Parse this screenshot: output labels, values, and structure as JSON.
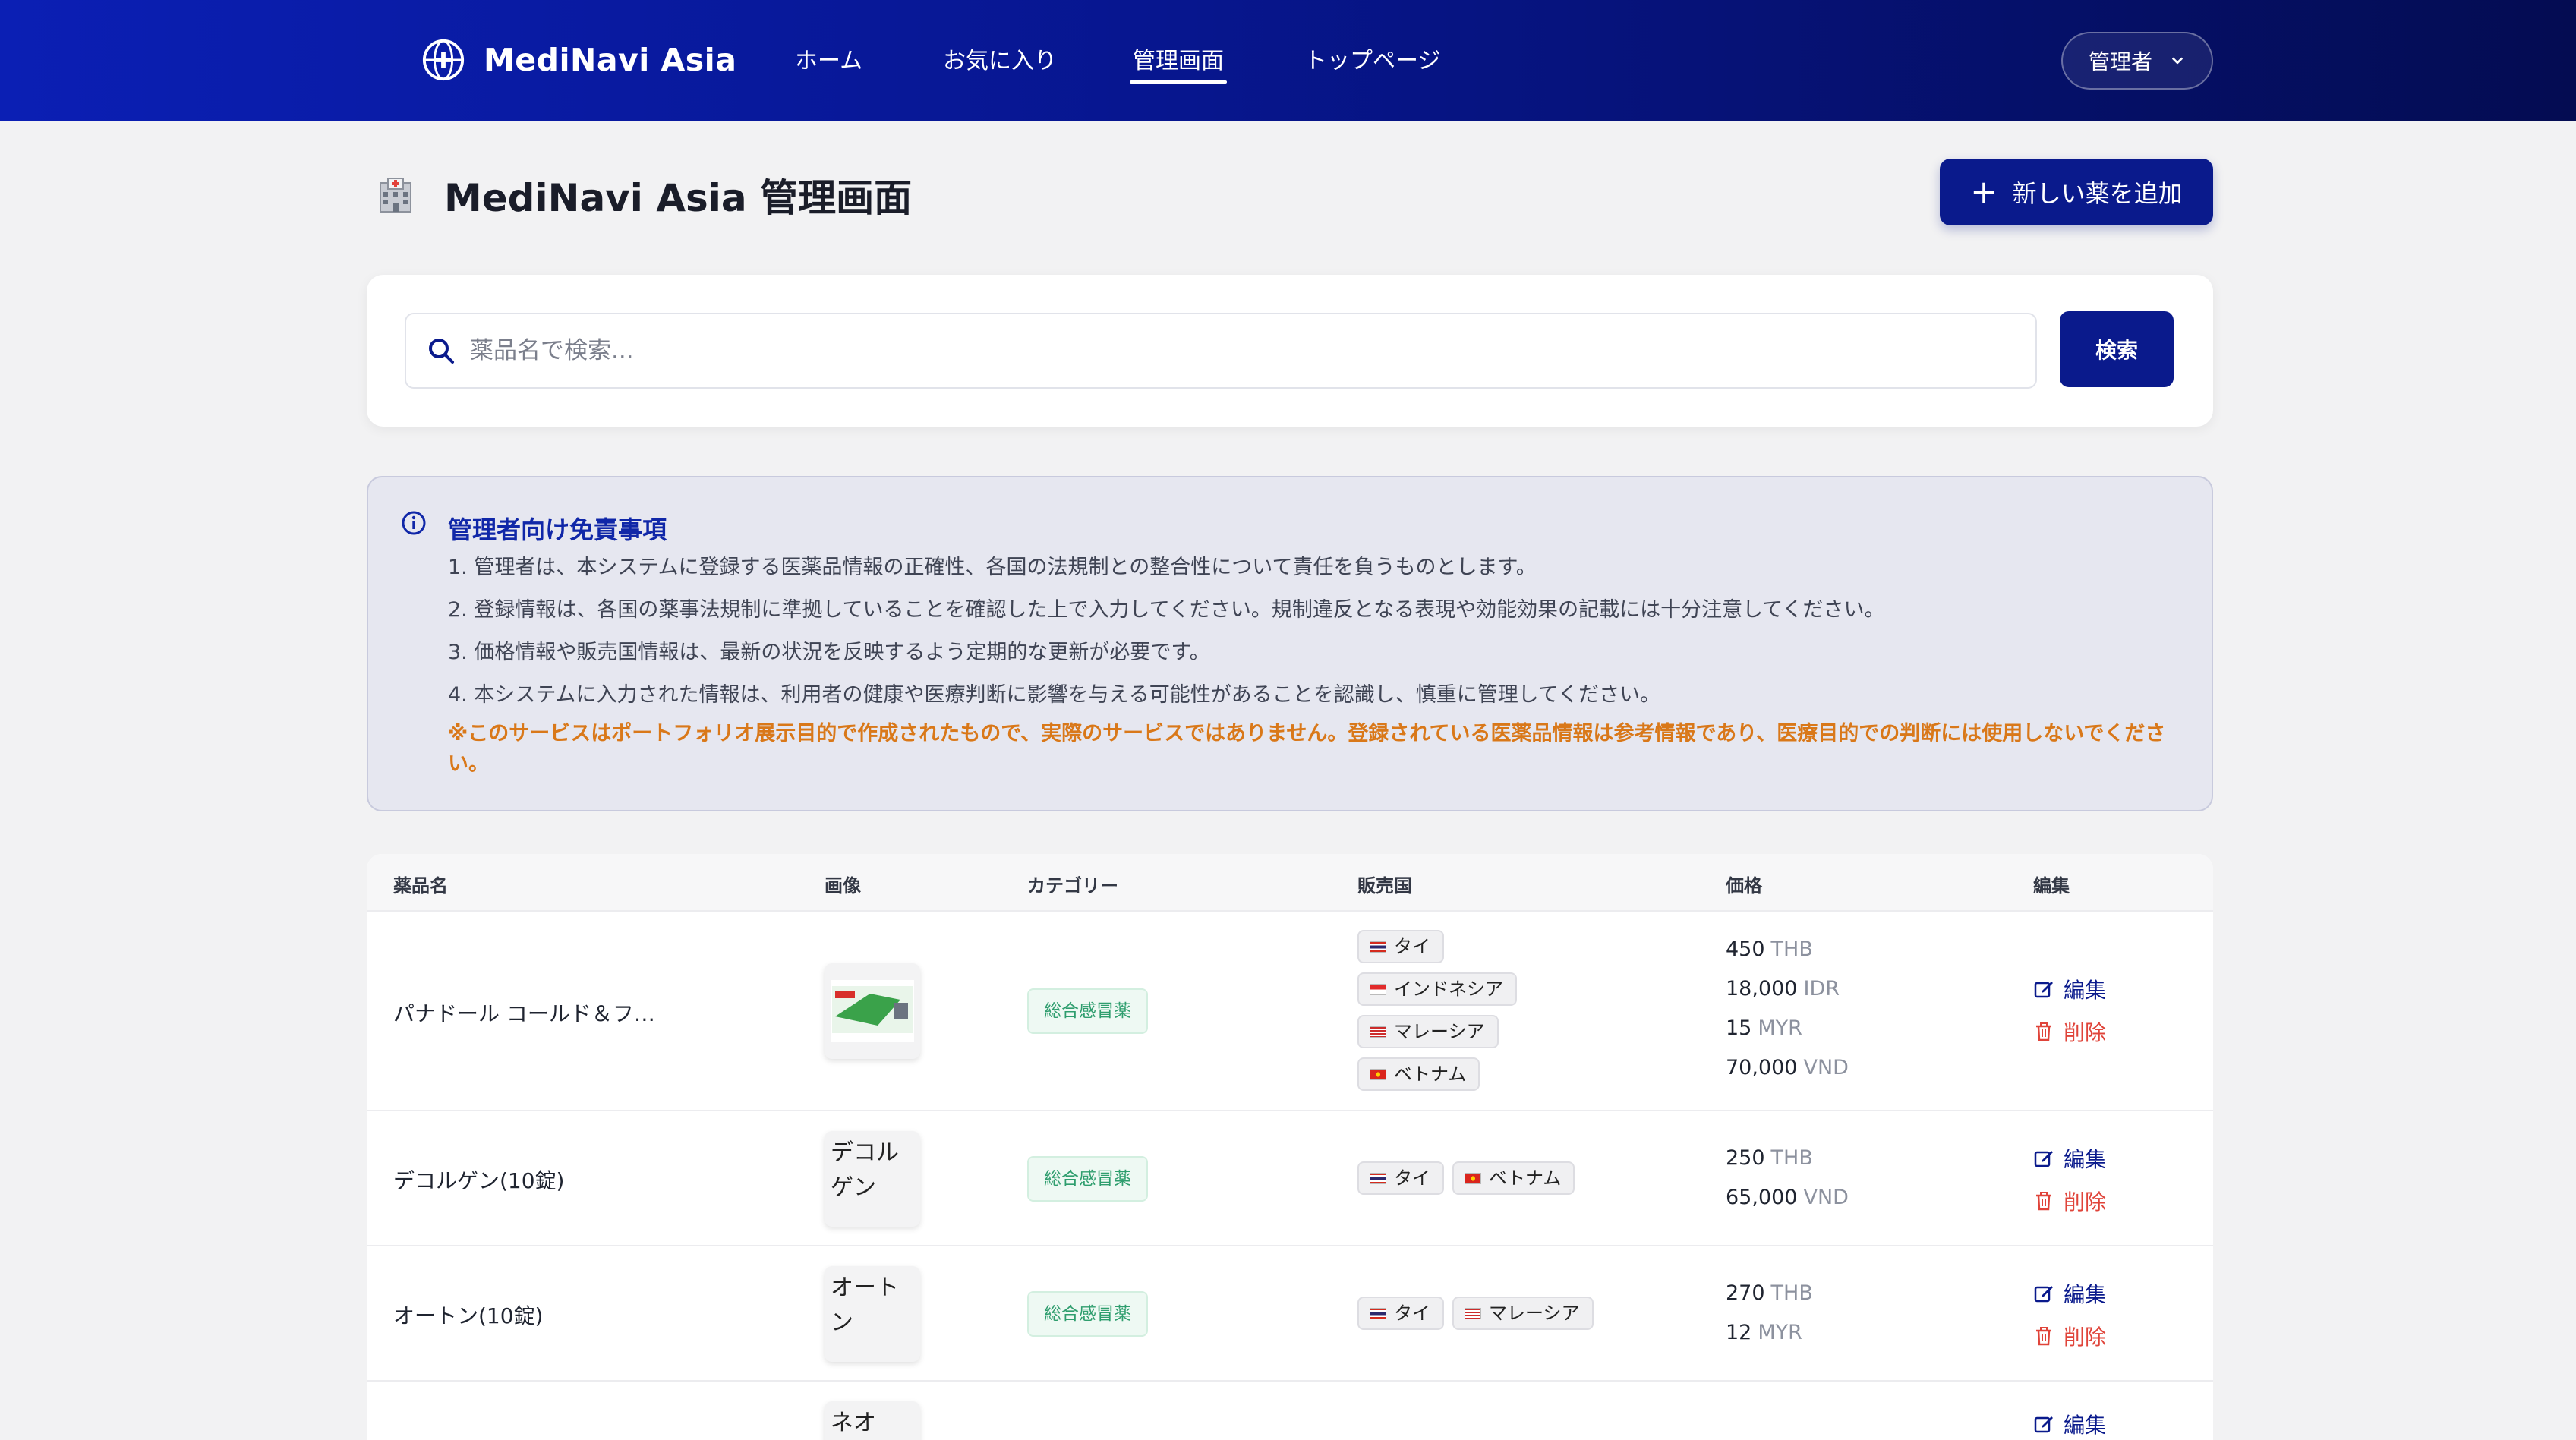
{
  "app": {
    "brand_name": "MediNavi Asia"
  },
  "nav": [
    {
      "label": "ホーム"
    },
    {
      "label": "お気に入り"
    },
    {
      "label": "管理画面",
      "active": true
    },
    {
      "label": "トップページ"
    }
  ],
  "user_menu": {
    "label": "管理者"
  },
  "page": {
    "title": "MediNavi Asia 管理画面",
    "add_button": "新しい薬を追加"
  },
  "search": {
    "placeholder": "薬品名で検索...",
    "button": "検索"
  },
  "disclaimer": {
    "title": "管理者向け免責事項",
    "items": [
      "1. 管理者は、本システムに登録する医薬品情報の正確性、各国の法規制との整合性について責任を負うものとします。",
      "2. 登録情報は、各国の薬事法規制に準拠していることを確認した上で入力してください。規制違反となる表現や効能効果の記載には十分注意してください。",
      "3. 価格情報や販売国情報は、最新の状況を反映するよう定期的な更新が必要です。",
      "4. 本システムに入力された情報は、利用者の健康や医療判断に影響を与える可能性があることを認識し、慎重に管理してください。"
    ],
    "warning": "※このサービスはポートフォリオ展示目的で作成されたもので、実際のサービスではありません。登録されている医薬品情報は参考情報であり、医療目的での判断には使用しないでください。"
  },
  "table": {
    "headers": [
      "薬品名",
      "画像",
      "カテゴリー",
      "販売国",
      "価格",
      "編集"
    ],
    "edit_label": "編集",
    "delete_label": "削除",
    "rows": [
      {
        "name": "パナドール コールド＆フ…",
        "image_alt": "",
        "category": "総合感冒薬",
        "countries": [
          "タイ",
          "インドネシア",
          "マレーシア",
          "ベトナム"
        ],
        "prices": [
          {
            "amount": "450",
            "currency": "THB"
          },
          {
            "amount": "18,000",
            "currency": "IDR"
          },
          {
            "amount": "15",
            "currency": "MYR"
          },
          {
            "amount": "70,000",
            "currency": "VND"
          }
        ]
      },
      {
        "name": "デコルゲン(10錠)",
        "image_alt": "デコルゲン",
        "category": "総合感冒薬",
        "countries": [
          "タイ",
          "ベトナム"
        ],
        "prices": [
          {
            "amount": "250",
            "currency": "THB"
          },
          {
            "amount": "65,000",
            "currency": "VND"
          }
        ]
      },
      {
        "name": "オートン(10錠)",
        "image_alt": "オートン",
        "category": "総合感冒薬",
        "countries": [
          "タイ",
          "マレーシア"
        ],
        "prices": [
          {
            "amount": "270",
            "currency": "THB"
          },
          {
            "amount": "12",
            "currency": "MYR"
          }
        ]
      },
      {
        "name": "",
        "image_alt": "ネオ",
        "category": "",
        "countries": [],
        "prices": []
      }
    ]
  }
}
